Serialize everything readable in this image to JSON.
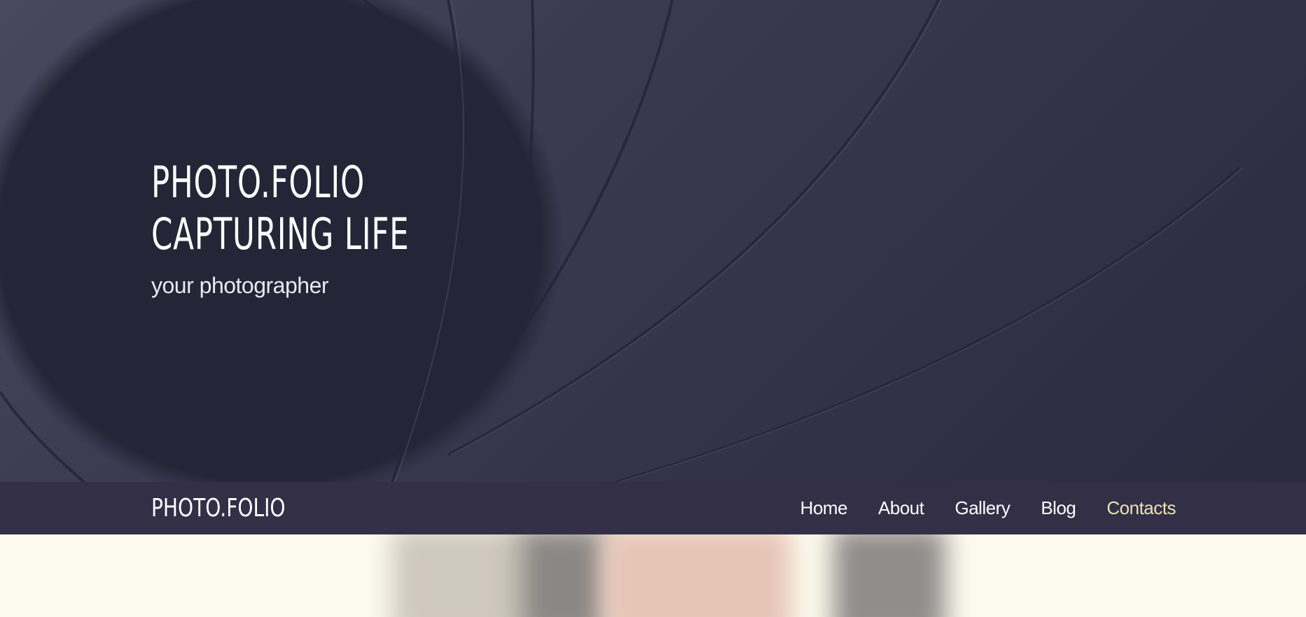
{
  "hero": {
    "title_line1": "PHOTO.FOLIO",
    "title_line2": "CAPTURING LIFE",
    "subtitle": "your photographer"
  },
  "navbar": {
    "brand": "PHOTO.FOLIO",
    "items": [
      {
        "label": "Home",
        "active": false
      },
      {
        "label": "About",
        "active": false
      },
      {
        "label": "Gallery",
        "active": false
      },
      {
        "label": "Blog",
        "active": false
      },
      {
        "label": "Contacts",
        "active": true
      }
    ]
  },
  "colors": {
    "hero_bg": "#33314a",
    "navbar_bg": "#322f47",
    "active_nav": "#ece2b4",
    "page_bg": "#fdfbee"
  }
}
